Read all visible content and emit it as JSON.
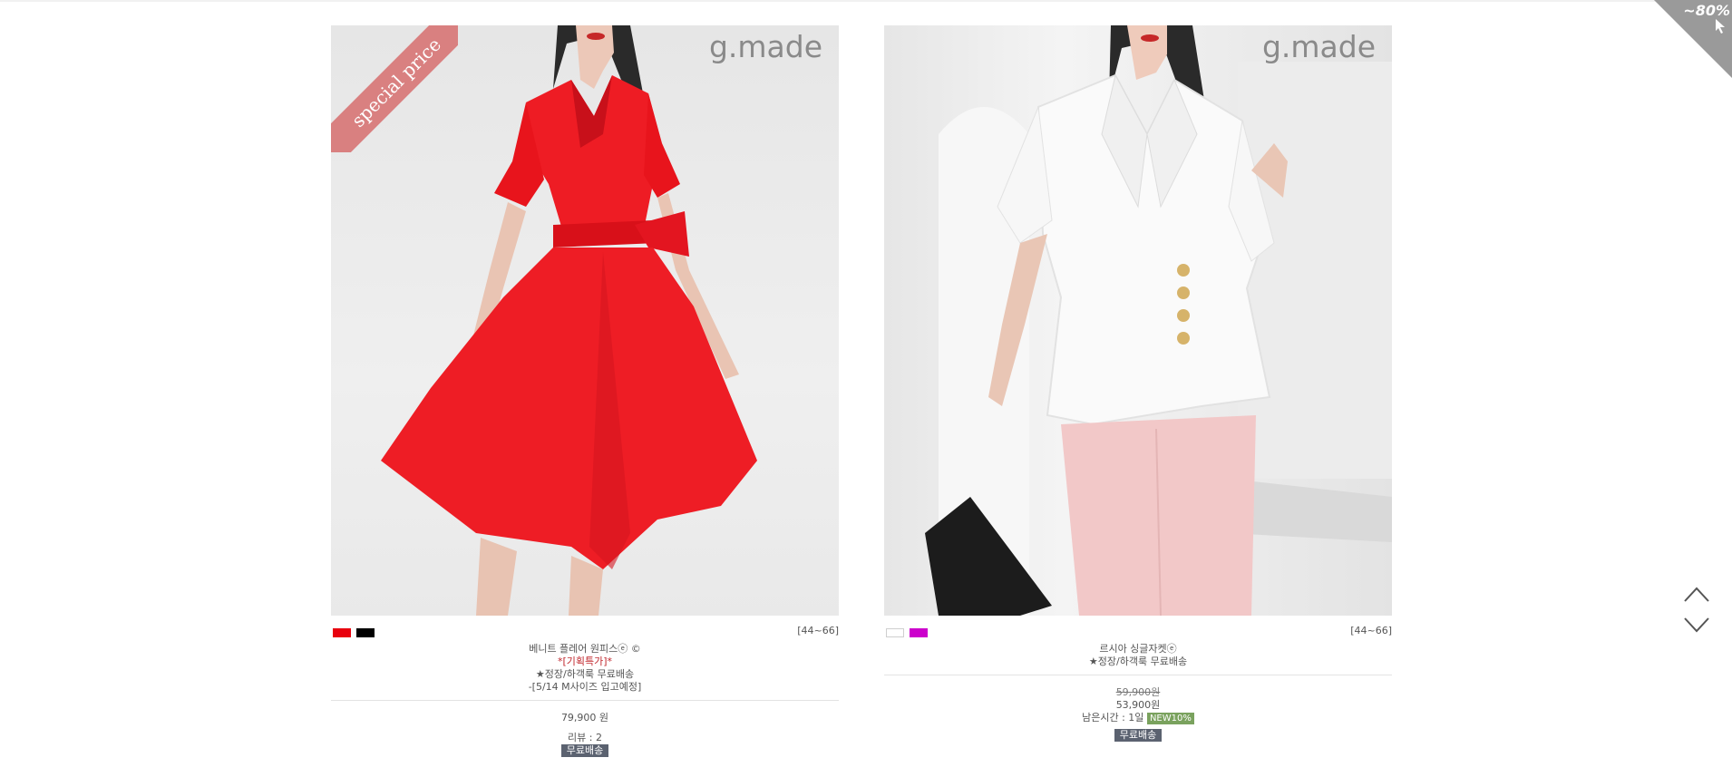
{
  "badge": {
    "zoom_text": "~80%"
  },
  "products": [
    {
      "brand": "g.made",
      "ribbon": "special price",
      "colors": [
        "#e8000e",
        "#000000"
      ],
      "size_range": "[44~66]",
      "name": "베니트 플레어 원피스ⓔ ©",
      "promo": "*[기획특가]*",
      "shipping_note": "★정장/하객룩 무료배송",
      "restock_note": "-[5/14 M사이즈 입고예정]",
      "price": "79,900 원",
      "review": "리뷰 : 2",
      "badge": "무료배송"
    },
    {
      "brand": "g.made",
      "colors": [
        "#ffffff",
        "#cc00cc"
      ],
      "size_range": "[44~66]",
      "name": "르시아 싱글자켓ⓔ",
      "shipping_note": "★정장/하객룩 무료배송",
      "original_price": "59,900원",
      "sale_price": "53,900원",
      "time_left": "남은시간 : 1일",
      "discount_badge": "NEW10%",
      "badge": "무료배송"
    }
  ]
}
